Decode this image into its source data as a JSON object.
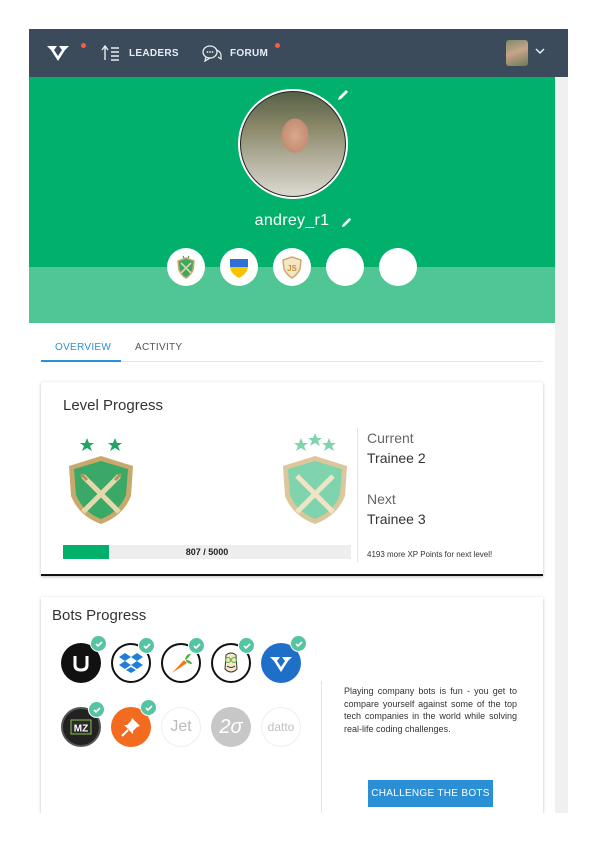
{
  "nav": {
    "leaders_label": "LEADERS",
    "forum_label": "FORUM",
    "notification_color": "#ff5a3c",
    "background_color": "#3b4b5c"
  },
  "profile": {
    "username": "andrey_r1",
    "hero_color": "#00b06b",
    "hero_lower_color": "#4fc694",
    "badges": [
      {
        "icon": "trainee-shield-icon"
      },
      {
        "icon": "ukraine-flag-shield-icon"
      },
      {
        "icon": "js-shield-icon"
      },
      {
        "icon": "empty-badge-slot"
      },
      {
        "icon": "empty-badge-slot"
      }
    ]
  },
  "tabs": [
    {
      "label": "OVERVIEW",
      "active": true
    },
    {
      "label": "ACTIVITY",
      "active": false
    }
  ],
  "level_progress": {
    "title": "Level Progress",
    "current_label": "Current",
    "current_level": "Trainee 2",
    "next_label": "Next",
    "next_level": "Trainee 3",
    "xp_text": "807 / 5000",
    "xp_current": 807,
    "xp_total": 5000,
    "xp_note": "4193 more XP Points for next level!"
  },
  "bots_progress": {
    "title": "Bots Progress",
    "description": "Playing company bots is fun - you get to compare yourself against some of the top tech companies in the world while solving real-life coding challenges.",
    "button_label": "CHALLENGE THE BOTS",
    "bots": [
      {
        "name": "uber-bot-icon",
        "completed": true
      },
      {
        "name": "dropbox-bot-icon",
        "completed": true
      },
      {
        "name": "carrot-bot-icon",
        "completed": true
      },
      {
        "name": "hipster-bot-icon",
        "completed": true
      },
      {
        "name": "codefights-bot-icon",
        "completed": true
      },
      {
        "name": "mz-bot-icon",
        "completed": true
      },
      {
        "name": "pin-bot-icon",
        "completed": true
      },
      {
        "name": "jet-bot-icon",
        "completed": false,
        "text": "Jet"
      },
      {
        "name": "two-sigma-bot-icon",
        "completed": false,
        "text": "2σ"
      },
      {
        "name": "datto-bot-icon",
        "completed": false,
        "text": "datto"
      }
    ]
  },
  "colors": {
    "accent_blue": "#2b8fd6",
    "progress_green": "#00b06b",
    "check_teal": "#55c4a2"
  }
}
